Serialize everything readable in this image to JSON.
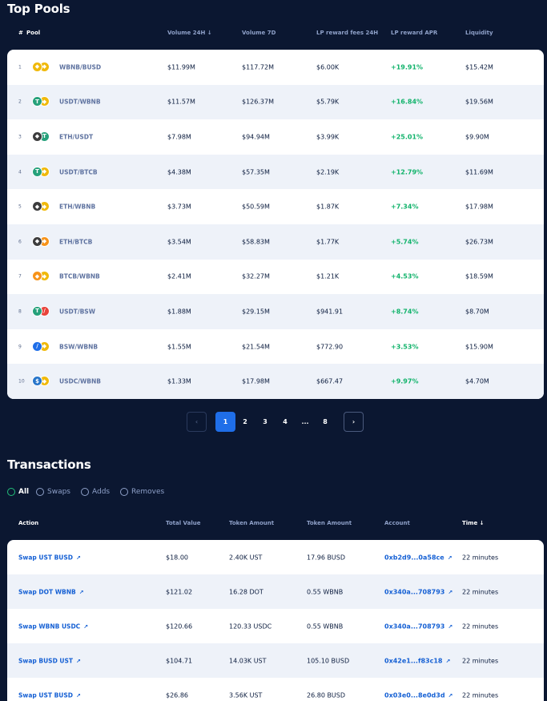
{
  "pools": {
    "title": "Top Pools",
    "headers": [
      "#",
      "Pool",
      "Volume 24H ↓",
      "Volume 7D",
      "LP reward fees 24H",
      "LP reward APR",
      "Liquidity"
    ],
    "rows": [
      {
        "num": "1",
        "pair": "WBNB/BUSD",
        "vol24": "$11.99M",
        "vol7": "$117.72M",
        "fees": "$6.00K",
        "apr": "+19.91%",
        "liq": "$15.42M",
        "c1": {
          "glyph": "◆",
          "color": "#f0b90b"
        },
        "c2": {
          "glyph": "◆",
          "color": "#f0b90b"
        }
      },
      {
        "num": "2",
        "pair": "USDT/WBNB",
        "vol24": "$11.57M",
        "vol7": "$126.37M",
        "fees": "$5.79K",
        "apr": "+16.84%",
        "liq": "$19.56M",
        "c1": {
          "glyph": "T",
          "color": "#26a17b"
        },
        "c2": {
          "glyph": "◆",
          "color": "#f0b90b"
        }
      },
      {
        "num": "3",
        "pair": "ETH/USDT",
        "vol24": "$7.98M",
        "vol7": "$94.94M",
        "fees": "$3.99K",
        "apr": "+25.01%",
        "liq": "$9.90M",
        "c1": {
          "glyph": "◆",
          "color": "#3c3c3d"
        },
        "c2": {
          "glyph": "T",
          "color": "#26a17b"
        }
      },
      {
        "num": "4",
        "pair": "USDT/BTCB",
        "vol24": "$4.38M",
        "vol7": "$57.35M",
        "fees": "$2.19K",
        "apr": "+12.79%",
        "liq": "$11.69M",
        "c1": {
          "glyph": "T",
          "color": "#26a17b"
        },
        "c2": {
          "glyph": "◆",
          "color": "#f0b90b"
        }
      },
      {
        "num": "5",
        "pair": "ETH/WBNB",
        "vol24": "$3.73M",
        "vol7": "$50.59M",
        "fees": "$1.87K",
        "apr": "+7.34%",
        "liq": "$17.98M",
        "c1": {
          "glyph": "◆",
          "color": "#3c3c3d"
        },
        "c2": {
          "glyph": "◆",
          "color": "#f0b90b"
        }
      },
      {
        "num": "6",
        "pair": "ETH/BTCB",
        "vol24": "$3.54M",
        "vol7": "$58.83M",
        "fees": "$1.77K",
        "apr": "+5.74%",
        "liq": "$26.73M",
        "c1": {
          "glyph": "◆",
          "color": "#3c3c3d"
        },
        "c2": {
          "glyph": "◆",
          "color": "#f7931a"
        }
      },
      {
        "num": "7",
        "pair": "BTCB/WBNB",
        "vol24": "$2.41M",
        "vol7": "$32.27M",
        "fees": "$1.21K",
        "apr": "+4.53%",
        "liq": "$18.59M",
        "c1": {
          "glyph": "◆",
          "color": "#f7931a"
        },
        "c2": {
          "glyph": "◆",
          "color": "#f0b90b"
        }
      },
      {
        "num": "8",
        "pair": "USDT/BSW",
        "vol24": "$1.88M",
        "vol7": "$29.15M",
        "fees": "$941.91",
        "apr": "+8.74%",
        "liq": "$8.70M",
        "c1": {
          "glyph": "T",
          "color": "#26a17b"
        },
        "c2": {
          "glyph": "/",
          "color": "#e8433b"
        }
      },
      {
        "num": "9",
        "pair": "BSW/WBNB",
        "vol24": "$1.55M",
        "vol7": "$21.54M",
        "fees": "$772.90",
        "apr": "+3.53%",
        "liq": "$15.90M",
        "c1": {
          "glyph": "/",
          "color": "#1f6ee8"
        },
        "c2": {
          "glyph": "◆",
          "color": "#f0b90b"
        }
      },
      {
        "num": "10",
        "pair": "USDC/WBNB",
        "vol24": "$1.33M",
        "vol7": "$17.98M",
        "fees": "$667.47",
        "apr": "+9.97%",
        "liq": "$4.70M",
        "c1": {
          "glyph": "$",
          "color": "#2775ca"
        },
        "c2": {
          "glyph": "◆",
          "color": "#f0b90b"
        }
      }
    ]
  },
  "pagination": {
    "prev": "‹",
    "next": "›",
    "pages": [
      "1",
      "2",
      "3",
      "4",
      "...",
      "8"
    ],
    "current": "1"
  },
  "transactions": {
    "title": "Transactions",
    "filters": [
      "All",
      "Swaps",
      "Adds",
      "Removes"
    ],
    "active_filter": "All",
    "headers": [
      "Action",
      "Total Value",
      "Token Amount",
      "Token Amount",
      "Account",
      "Time ↓"
    ],
    "external_glyph": "↗",
    "rows": [
      {
        "action": "Swap UST BUSD",
        "total": "$18.00",
        "amt1": "2.40K UST",
        "amt2": "17.96 BUSD",
        "account": "0xb2d9...0a58ce",
        "time": "22 minutes"
      },
      {
        "action": "Swap DOT WBNB",
        "total": "$121.02",
        "amt1": "16.28 DOT",
        "amt2": "0.55 WBNB",
        "account": "0x340a...708793",
        "time": "22 minutes"
      },
      {
        "action": "Swap WBNB USDC",
        "total": "$120.66",
        "amt1": "120.33 USDC",
        "amt2": "0.55 WBNB",
        "account": "0x340a...708793",
        "time": "22 minutes"
      },
      {
        "action": "Swap BUSD UST",
        "total": "$104.71",
        "amt1": "14.03K UST",
        "amt2": "105.10 BUSD",
        "account": "0x42e1...f83c18",
        "time": "22 minutes"
      },
      {
        "action": "Swap UST BUSD",
        "total": "$26.86",
        "amt1": "3.56K UST",
        "amt2": "26.80 BUSD",
        "account": "0x03e0...8e0d3d",
        "time": "22 minutes"
      }
    ]
  }
}
